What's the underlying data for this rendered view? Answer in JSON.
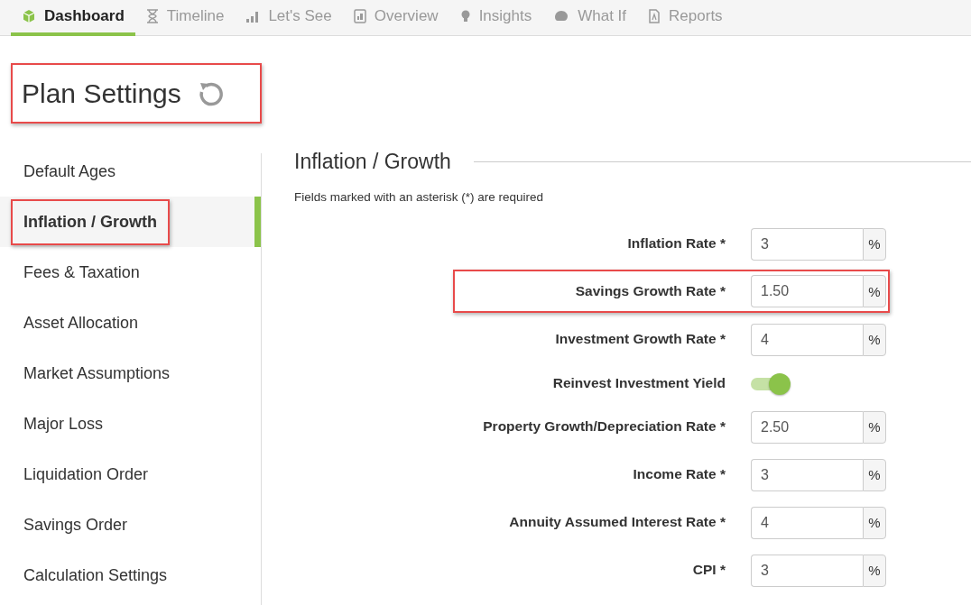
{
  "tabs": [
    {
      "label": "Dashboard",
      "selected": true
    },
    {
      "label": "Timeline",
      "selected": false
    },
    {
      "label": "Let's See",
      "selected": false
    },
    {
      "label": "Overview",
      "selected": false
    },
    {
      "label": "Insights",
      "selected": false
    },
    {
      "label": "What If",
      "selected": false
    },
    {
      "label": "Reports",
      "selected": false
    }
  ],
  "page_title": {
    "text": "Plan Settings",
    "highlighted": true
  },
  "sidebar": {
    "items": [
      {
        "label": "Default Ages",
        "selected": false,
        "highlighted": false
      },
      {
        "label": "Inflation / Growth",
        "selected": true,
        "highlighted": true
      },
      {
        "label": "Fees & Taxation",
        "selected": false,
        "highlighted": false
      },
      {
        "label": "Asset Allocation",
        "selected": false,
        "highlighted": false
      },
      {
        "label": "Market Assumptions",
        "selected": false,
        "highlighted": false
      },
      {
        "label": "Major Loss",
        "selected": false,
        "highlighted": false
      },
      {
        "label": "Liquidation Order",
        "selected": false,
        "highlighted": false
      },
      {
        "label": "Savings Order",
        "selected": false,
        "highlighted": false
      },
      {
        "label": "Calculation Settings",
        "selected": false,
        "highlighted": false
      }
    ]
  },
  "section": {
    "heading": "Inflation / Growth",
    "note": "Fields marked with an asterisk (*) are required"
  },
  "fields": [
    {
      "kind": "percent",
      "label": "Inflation Rate *",
      "value": "3",
      "unit": "%",
      "highlighted": false
    },
    {
      "kind": "percent",
      "label": "Savings Growth Rate *",
      "value": "1.50",
      "unit": "%",
      "highlighted": true
    },
    {
      "kind": "percent",
      "label": "Investment Growth Rate *",
      "value": "4",
      "unit": "%",
      "highlighted": false
    },
    {
      "kind": "toggle",
      "label": "Reinvest Investment Yield",
      "on": true,
      "highlighted": false
    },
    {
      "kind": "percent",
      "label": "Property Growth/Depreciation Rate *",
      "value": "2.50",
      "unit": "%",
      "highlighted": false
    },
    {
      "kind": "percent",
      "label": "Income Rate *",
      "value": "3",
      "unit": "%",
      "highlighted": false
    },
    {
      "kind": "percent",
      "label": "Annuity Assumed Interest Rate *",
      "value": "4",
      "unit": "%",
      "highlighted": false
    },
    {
      "kind": "percent",
      "label": "CPI *",
      "value": "3",
      "unit": "%",
      "highlighted": false
    }
  ]
}
